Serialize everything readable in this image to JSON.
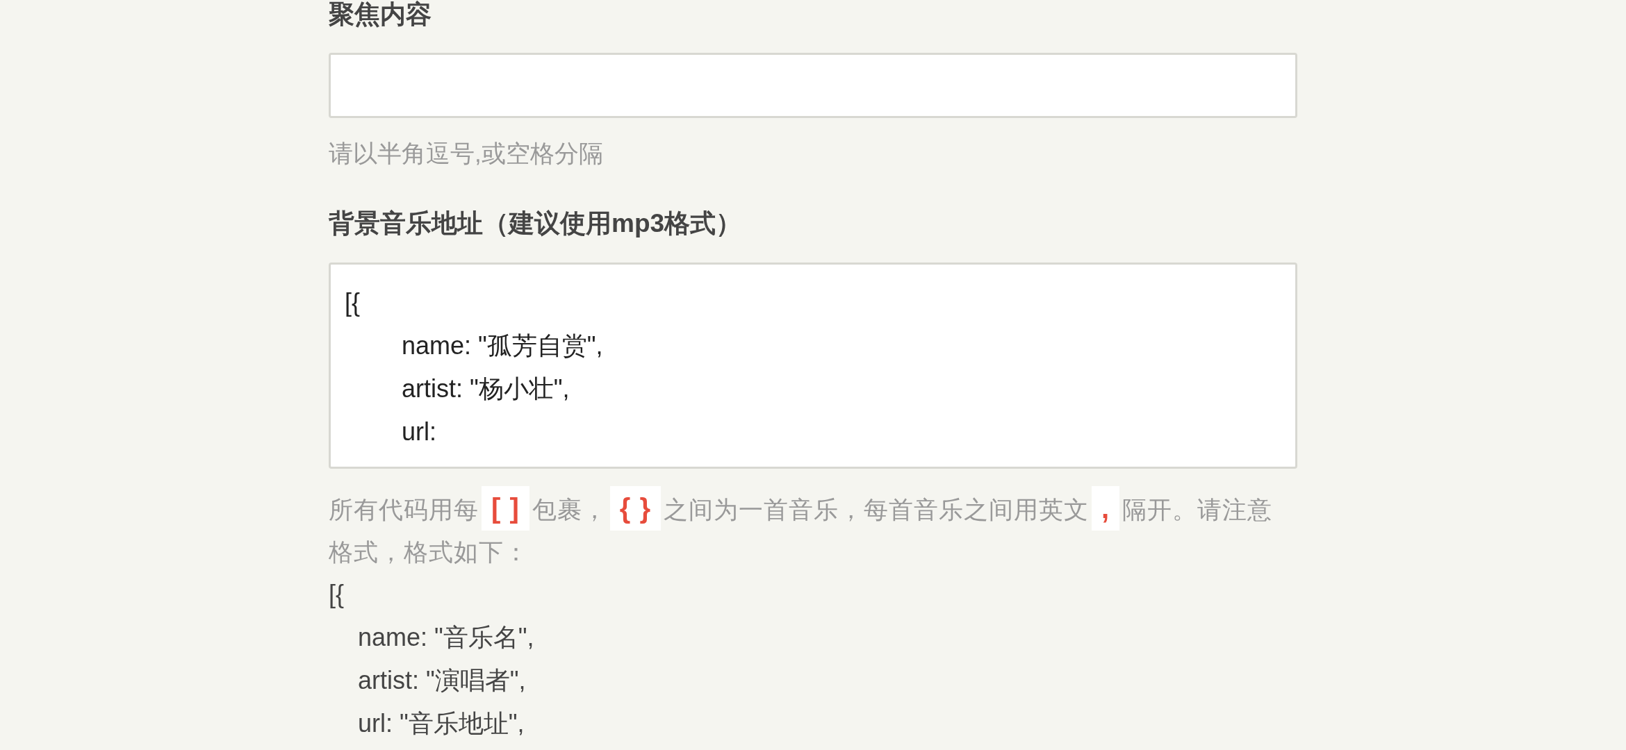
{
  "fields": [
    {
      "kind": "input",
      "label": "聚焦内容",
      "hint": "请以半角逗号,或空格分隔"
    },
    {
      "kind": "textarea",
      "label": "背景音乐地址（建议使用mp3格式）",
      "lines": [
        {
          "text": "[{",
          "indented": false
        },
        {
          "text": "name: \"孤芳自赏\",",
          "indented": true
        },
        {
          "text": "artist: \"杨小壮\",",
          "indented": true
        },
        {
          "text": "url:",
          "indented": true
        }
      ],
      "help": [
        {
          "kind": "text",
          "text": "所有代码用每"
        },
        {
          "kind": "code",
          "text": "[ ]"
        },
        {
          "kind": "text",
          "text": "包裹，"
        },
        {
          "kind": "code",
          "text": "{ }"
        },
        {
          "kind": "text",
          "text": "之间为一首音乐，每首音乐之间用英文"
        },
        {
          "kind": "code",
          "text": ","
        },
        {
          "kind": "text",
          "text": "隔开。请注意格式，格式如下："
        }
      ],
      "example": [
        {
          "text": "[{",
          "indented": false
        },
        {
          "text": "name: \"音乐名\",",
          "indented": true
        },
        {
          "text": "artist: \"演唱者\",",
          "indented": true
        },
        {
          "text": "url: \"音乐地址\",",
          "indented": true
        }
      ]
    }
  ]
}
